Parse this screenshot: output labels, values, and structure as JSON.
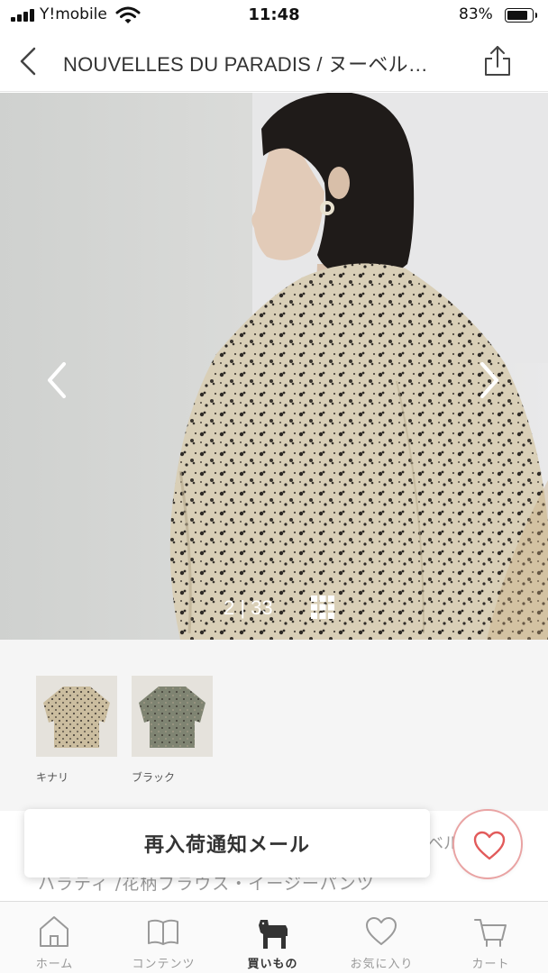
{
  "status_bar": {
    "carrier": "Y!mobile",
    "time": "11:48",
    "battery_percent": "83%",
    "battery_level": 0.83,
    "icons": [
      "signal-icon",
      "wifi-icon",
      "battery-icon"
    ]
  },
  "header": {
    "title": "NOUVELLES DU PARADIS / ヌーベル…",
    "back_icon": "chevron-left-icon",
    "share_icon": "share-icon"
  },
  "gallery": {
    "counter": "2 | 33",
    "prev_icon": "chevron-left-icon",
    "next_icon": "chevron-right-icon",
    "grid_icon": "grid-icon"
  },
  "color_variants": [
    {
      "label": "キナリ",
      "swatch": "#c9b99b"
    },
    {
      "label": "ブラック",
      "swatch": "#7f8472"
    }
  ],
  "product": {
    "brand_tail": "ベル",
    "name": "ハラティ /花柄ブラウス・イージーパンツ"
  },
  "actions": {
    "restock_label": "再入荷通知メール",
    "favorite_icon": "heart-icon",
    "favorite_color": "#e25b5b"
  },
  "tab_bar": {
    "tabs": [
      {
        "label": "ホーム",
        "icon": "home-icon",
        "active": false
      },
      {
        "label": "コンテンツ",
        "icon": "book-icon",
        "active": false
      },
      {
        "label": "買いもの",
        "icon": "horse-icon",
        "active": true
      },
      {
        "label": "お気に入り",
        "icon": "heart-icon",
        "active": false
      },
      {
        "label": "カート",
        "icon": "cart-icon",
        "active": false
      }
    ]
  }
}
